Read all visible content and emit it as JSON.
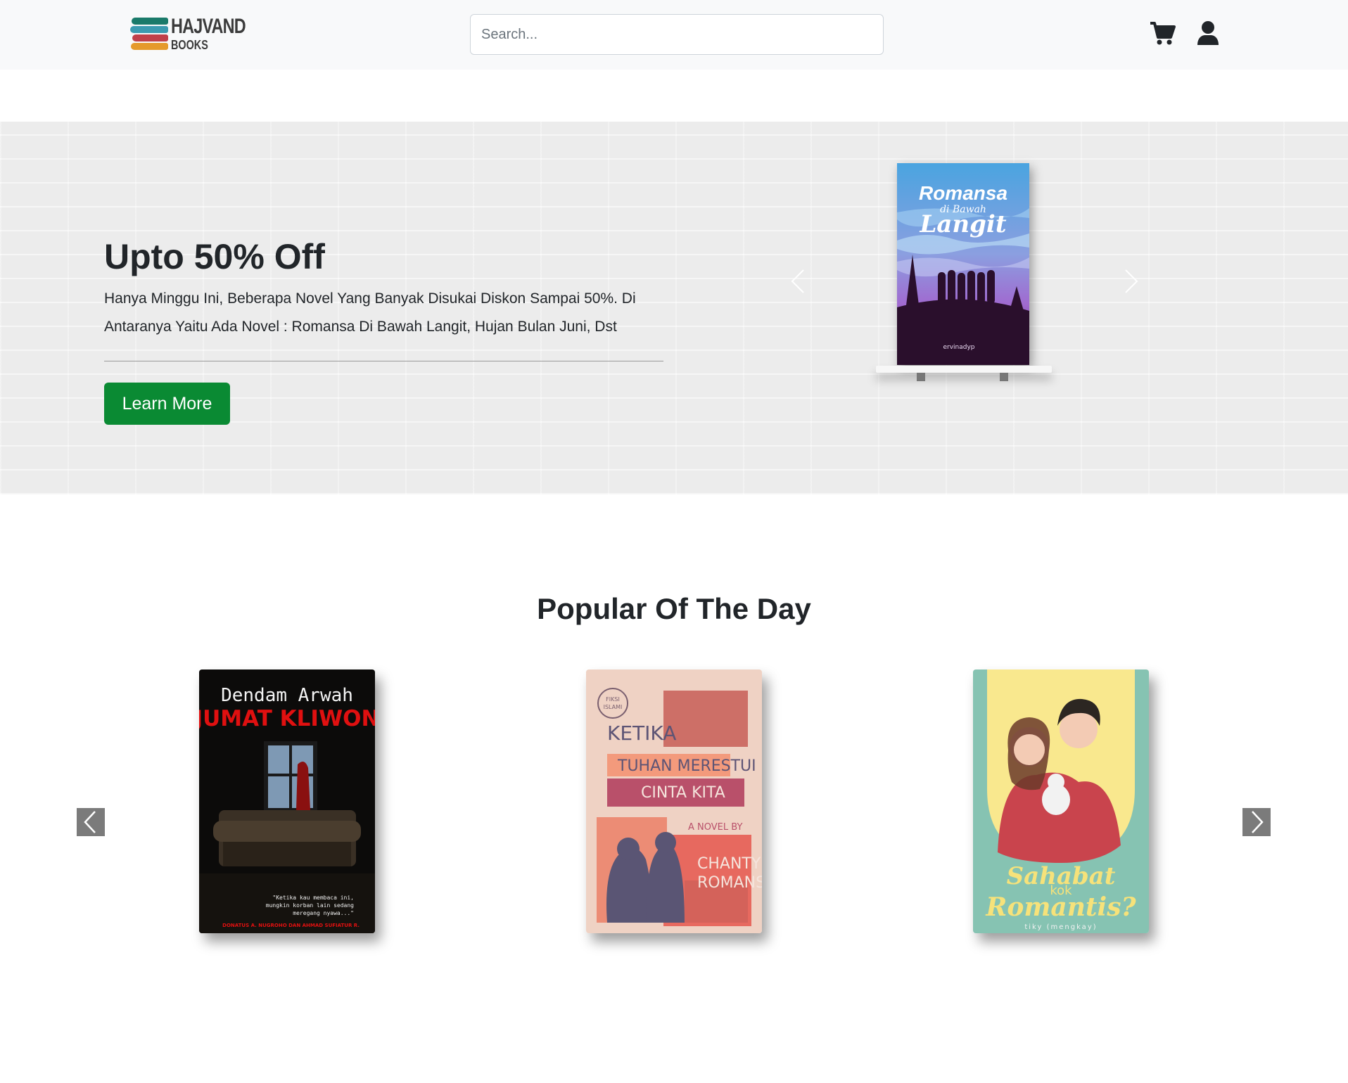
{
  "brand": {
    "name": "HAJVAND",
    "sub": "BOOKS"
  },
  "search": {
    "placeholder": "Search..."
  },
  "icons": {
    "cart": "cart-icon",
    "user": "user-icon"
  },
  "hero": {
    "title": "Upto 50% Off",
    "text": "Hanya Minggu Ini, Beberapa Novel Yang Banyak Disukai Diskon Sampai 50%. Di Antaranya Yaitu Ada Novel : Romansa Di Bawah Langit, Hujan Bulan Juni, Dst",
    "button_label": "Learn More",
    "book": {
      "title_line1": "Romansa",
      "title_line2": "di Bawah",
      "title_line3": "Langit",
      "author": "ervinadyp"
    },
    "colors": {
      "button": "#0a8a33"
    }
  },
  "popular": {
    "title": "Popular Of The Day",
    "books": [
      {
        "title_top": "Dendam Arwah",
        "title_main": "JUMAT KLIWON",
        "quote_line1": "\"Ketika kau membaca ini,",
        "quote_line2": "mungkin korban lain sedang",
        "quote_line3": "meregang nyawa...\"",
        "author": "DONATUS A. NUGROHO DAN AHMAD SUFIATUR R."
      },
      {
        "badge_line1": "FIKSI",
        "badge_line2": "ISLAMI",
        "line1": "KETIKA",
        "line2": "TUHAN MERESTUI",
        "line3": "CINTA KITA",
        "byline": "A NOVEL BY",
        "author_line1": "CHANTY",
        "author_line2": "ROMANS"
      },
      {
        "title_line1": "Sahabat",
        "title_line2": "kok",
        "title_line3": "Romantis?",
        "author": "tiky (mengkay)"
      }
    ]
  }
}
